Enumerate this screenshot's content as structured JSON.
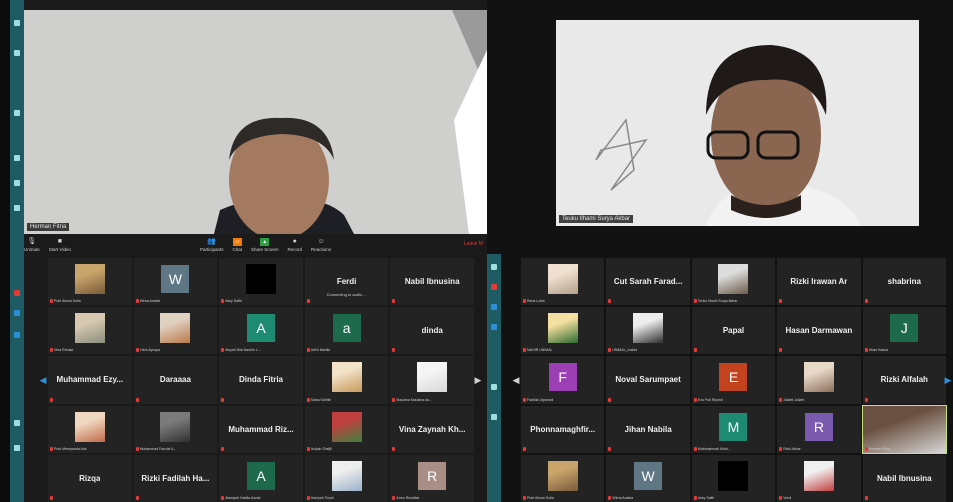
{
  "left": {
    "speaker_label": "Herman Fitria",
    "toolbar": {
      "buttons": [
        {
          "id": "unmute",
          "label": "Unmute",
          "icon": "mic-icon",
          "color": "#d0d0d0"
        },
        {
          "id": "start-video",
          "label": "Start Video",
          "icon": "camera-icon",
          "color": "#d0d0d0"
        },
        {
          "id": "participants",
          "label": "Participants",
          "icon": "people-icon",
          "badge": "45",
          "color": "#d0d0d0"
        },
        {
          "id": "chat",
          "label": "Chat",
          "icon": "chat-icon",
          "color": "#f57c00"
        },
        {
          "id": "share-screen",
          "label": "Share Screen",
          "icon": "share-icon",
          "color": "#2e9e40"
        },
        {
          "id": "record",
          "label": "Record",
          "icon": "record-icon",
          "color": "#d0d0d0"
        },
        {
          "id": "reactions",
          "label": "Reactions",
          "icon": "smile-icon",
          "color": "#d0d0d0"
        }
      ],
      "leave": "Leave M"
    },
    "tiles": [
      {
        "type": "photo",
        "caption": "Putri Aisma Sofia",
        "colors": [
          "#7a5b3a",
          "#c9a46b"
        ]
      },
      {
        "type": "avatar",
        "letter": "W",
        "bg": "#5f7684",
        "caption": "Wirna Anabia"
      },
      {
        "type": "black",
        "caption": "Asky Saffri"
      },
      {
        "type": "name",
        "name": "Ferdi",
        "sub": "Connecting to audio ..."
      },
      {
        "type": "name",
        "name": "Nabil Ibnusina"
      },
      {
        "type": "photo",
        "caption": "Vera Renata",
        "colors": [
          "#8a8f7d",
          "#d8c8b0"
        ]
      },
      {
        "type": "photo",
        "caption": "Yoba Aynaya",
        "colors": [
          "#b97a48",
          "#e0d0c0"
        ]
      },
      {
        "type": "avatar",
        "letter": "A",
        "bg": "#1f8a72",
        "caption": "Aisyah Nila Nasrim L..."
      },
      {
        "type": "avatar",
        "letter": "a",
        "bg": "#1e6a4d",
        "caption": "Arfini Martila"
      },
      {
        "type": "name",
        "name": "dinda"
      },
      {
        "type": "name",
        "name": "Muhammad  Ezy..."
      },
      {
        "type": "name",
        "name": "Daraaaa"
      },
      {
        "type": "name",
        "name": "Dinda Fitria"
      },
      {
        "type": "photo",
        "caption": "Salsa Sahfitri",
        "colors": [
          "#c79a5a",
          "#f2e2c8"
        ]
      },
      {
        "type": "photo",
        "caption": "Maulana Maulana As...",
        "colors": [
          "#d8d8d8",
          "#f5f5f5"
        ]
      },
      {
        "type": "photo",
        "caption": "Putri Mempanda Aris",
        "colors": [
          "#c06a4a",
          "#f0d8c0"
        ]
      },
      {
        "type": "photo",
        "caption": "Muhammad Fauzial A...",
        "colors": [
          "#303030",
          "#7b7b7b"
        ]
      },
      {
        "type": "name",
        "name": "Muhammad  Riz..."
      },
      {
        "type": "photo",
        "caption": "Aulyah Zhafjil",
        "colors": [
          "#3f8040",
          "#c04040"
        ]
      },
      {
        "type": "name",
        "name": "Vina Zaynah Kh..."
      },
      {
        "type": "name",
        "name": "Rizqa"
      },
      {
        "type": "name",
        "name": "Rizki Fadilah Ha..."
      },
      {
        "type": "avatar",
        "letter": "A",
        "bg": "#1e6a4d",
        "caption": "Alawiyah Nabila Azzah"
      },
      {
        "type": "photo",
        "caption": "Haniyah Tinyiri",
        "colors": [
          "#9ab0c8",
          "#eeeeee"
        ]
      },
      {
        "type": "avatar",
        "letter": "R",
        "bg": "#a98e85",
        "caption": "Amru Ricahtiar"
      }
    ]
  },
  "right": {
    "speaker_label": "Teuku Ilhami Surya Akbar",
    "tiles": [
      {
        "type": "photo",
        "caption": "Rena Lubis",
        "colors": [
          "#b3a08c",
          "#f0e0d0"
        ]
      },
      {
        "type": "name",
        "name": "Cut Sarah Farad..."
      },
      {
        "type": "photo",
        "caption": "Teuku Ilhami Surya Akbar",
        "colors": [
          "#6b5a4a",
          "#dcdcdc"
        ]
      },
      {
        "type": "name",
        "name": "Rizki Irawan Ar"
      },
      {
        "type": "name",
        "name": "shabrina"
      },
      {
        "type": "photo",
        "caption": "MAHIR UNIMAL",
        "colors": [
          "#2f6a2f",
          "#f4e0a0"
        ]
      },
      {
        "type": "photo",
        "caption": "UNIMAL_mahid",
        "colors": [
          "#2e2e2e",
          "#eeeeee"
        ]
      },
      {
        "type": "name",
        "name": "Papal"
      },
      {
        "type": "name",
        "name": "Hasan Darmawan"
      },
      {
        "type": "avatar",
        "letter": "J",
        "bg": "#1e6a4d",
        "caption": "Jihan Hasna"
      },
      {
        "type": "avatar",
        "letter": "F",
        "bg": "#9c3fb5",
        "caption": "Fadhila Utyaranti"
      },
      {
        "type": "name",
        "name": "Noval Sarumpaet"
      },
      {
        "type": "avatar",
        "letter": "E",
        "bg": "#c4431f",
        "caption": "Eva Puti Riyanti"
      },
      {
        "type": "photo",
        "caption": "Juliarti Juliarti",
        "colors": [
          "#8a6f5a",
          "#e8d8c8"
        ]
      },
      {
        "type": "name",
        "name": "Rizki Alfalah"
      },
      {
        "type": "name",
        "name": "Phonnamaghfir..."
      },
      {
        "type": "name",
        "name": "Jihan Nabila"
      },
      {
        "type": "avatar",
        "letter": "M",
        "bg": "#1f8a72",
        "caption": "Muthmainnah Muth..."
      },
      {
        "type": "avatar",
        "letter": "R",
        "bg": "#7a5bb0",
        "caption": "Rizki Akbar"
      },
      {
        "type": "photo",
        "caption": "Herman Fitria",
        "colors": [
          "#d8d8d8",
          "#6a5040"
        ],
        "active": true
      },
      {
        "type": "photo",
        "caption": "Putri Aisma Sofia",
        "colors": [
          "#7a5b3a",
          "#c9a46b"
        ]
      },
      {
        "type": "avatar",
        "letter": "W",
        "bg": "#5f7684",
        "caption": "Wirna Anabia"
      },
      {
        "type": "black",
        "caption": "Asky Saffri"
      },
      {
        "type": "photo",
        "caption": "Vordi",
        "colors": [
          "#c04040",
          "#f0f0f0"
        ]
      },
      {
        "type": "name",
        "name": "Nabil Ibnusina"
      }
    ]
  },
  "colors": {
    "accent": "#f57c00",
    "mic_off": "#e53935",
    "sidebar": "#1f5b63",
    "active_border": "#c8e27a"
  }
}
